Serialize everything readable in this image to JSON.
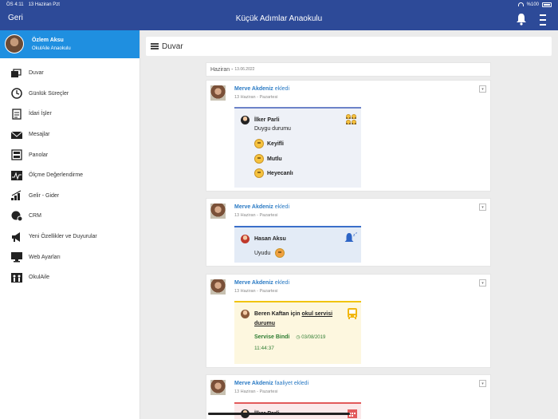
{
  "status": {
    "time": "ÖS 4:11",
    "date": "13 Haziran Pzt",
    "battery": "%100"
  },
  "nav": {
    "back": "Geri",
    "title": "Küçük Adımlar Anaokulu"
  },
  "profile": {
    "name": "Özlem Aksu",
    "school": "OkulAile Anaokulu"
  },
  "menu": [
    {
      "label": "Duvar",
      "icon": "wall-icon"
    },
    {
      "label": "Günlük Süreçler",
      "icon": "clock-icon"
    },
    {
      "label": "İdari İşler",
      "icon": "clipboard-icon"
    },
    {
      "label": "Mesajlar",
      "icon": "envelope-icon"
    },
    {
      "label": "Panolar",
      "icon": "board-icon"
    },
    {
      "label": "Ölçme Değerlendirme",
      "icon": "chart-icon"
    },
    {
      "label": "Gelir - Gider",
      "icon": "bar-chart-icon"
    },
    {
      "label": "CRM",
      "icon": "crm-icon"
    },
    {
      "label": "Yeni Özellikler ve Duyurular",
      "icon": "megaphone-icon"
    },
    {
      "label": "Web Ayarları",
      "icon": "monitor-icon"
    },
    {
      "label": "OkulAile",
      "icon": "family-icon"
    }
  ],
  "page": {
    "title": "Duvar"
  },
  "feed": {
    "month": "Haziran -",
    "month_date": "13.06.2022",
    "cards": [
      {
        "author": "Merve Akdeniz",
        "action": "ekledi",
        "date": "13 Haziran - Pazartesi",
        "person": "İlker Parli",
        "subtitle": "Duygu durumu",
        "moods": [
          "Keyifli",
          "Mutlu",
          "Heyecanlı"
        ]
      },
      {
        "author": "Merve Akdeniz",
        "action": "ekledi",
        "date": "13 Haziran - Pazartesi",
        "person": "Hasan Aksu",
        "status": "Uyudu"
      },
      {
        "author": "Merve Akdeniz",
        "action": "ekledi",
        "date": "13 Haziran - Pazartesi",
        "person_prefix": "Beren Kaftan için",
        "link1": "okul servisi",
        "link2": "durumu",
        "status": "Servise Bindi",
        "status_date": "03/08/2019",
        "time": "11:44:37"
      },
      {
        "author": "Merve Akdeniz",
        "action": "faaliyet ekledi",
        "date": "13 Haziran - Pazartesi",
        "person": "İlker Parli"
      }
    ]
  },
  "colors": {
    "nav": "#2d4a98",
    "profile": "#1f8fe0",
    "link": "#2a7ac4"
  }
}
